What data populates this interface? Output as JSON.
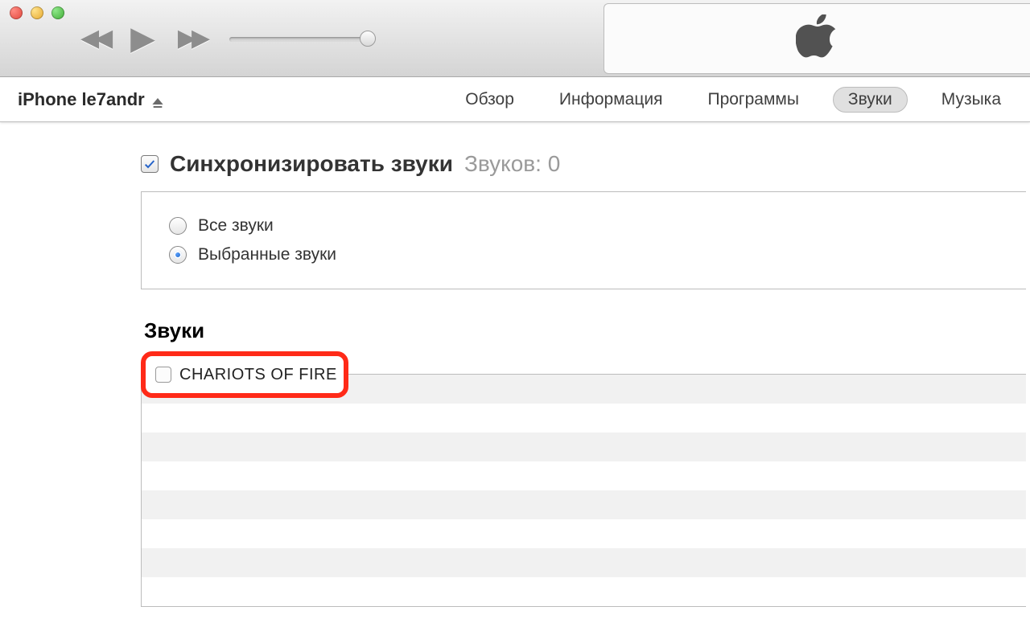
{
  "device": {
    "name": "iPhone le7andr"
  },
  "tabs": {
    "overview": "Обзор",
    "info": "Информация",
    "apps": "Программы",
    "sounds": "Звуки",
    "music": "Музыка"
  },
  "sync": {
    "checkbox_checked": true,
    "label": "Синхронизировать звуки",
    "count_label": "Звуков: 0",
    "radio_all": "Все звуки",
    "radio_selected": "Выбранные звуки"
  },
  "sounds": {
    "section_title": "Звуки",
    "items": [
      {
        "label": "CHARIOTS OF FIRE",
        "checked": false
      }
    ]
  }
}
